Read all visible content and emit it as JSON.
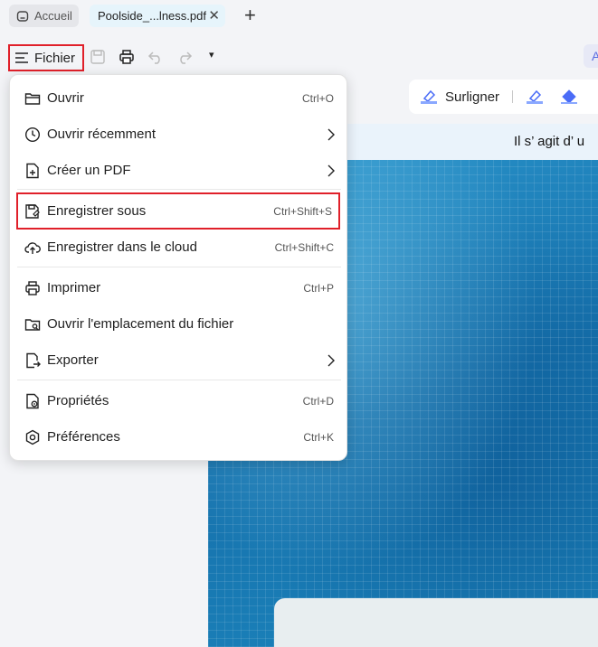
{
  "tabs": {
    "home_label": "Accueil",
    "doc_label": "Poolside_...lness.pdf",
    "close_glyph": "✕",
    "add_glyph": "+"
  },
  "toolbar": {
    "file_label": "Fichier",
    "more_glyph": "▾",
    "right_partial": "A"
  },
  "annotation": {
    "highlight_label": "Surligner"
  },
  "document": {
    "header_text": "Il s’ agit d’ u"
  },
  "menu": {
    "items": [
      {
        "label": "Ouvrir",
        "shortcut": "Ctrl+O",
        "icon": "folder-open-icon"
      },
      {
        "label": "Ouvrir récemment",
        "shortcut": "",
        "icon": "clock-icon",
        "submenu": true
      },
      {
        "label": "Créer un PDF",
        "shortcut": "",
        "icon": "create-pdf-icon",
        "submenu": true
      },
      {
        "label": "Enregistrer sous",
        "shortcut": "Ctrl+Shift+S",
        "icon": "save-as-icon",
        "highlighted": true
      },
      {
        "label": "Enregistrer dans le cloud",
        "shortcut": "Ctrl+Shift+C",
        "icon": "cloud-upload-icon"
      },
      {
        "label": "Imprimer",
        "shortcut": "Ctrl+P",
        "icon": "printer-icon"
      },
      {
        "label": "Ouvrir l'emplacement du fichier",
        "shortcut": "",
        "icon": "folder-location-icon"
      },
      {
        "label": "Exporter",
        "shortcut": "",
        "icon": "export-icon",
        "submenu": true
      },
      {
        "label": "Propriétés",
        "shortcut": "Ctrl+D",
        "icon": "properties-icon"
      },
      {
        "label": "Préférences",
        "shortcut": "Ctrl+K",
        "icon": "preferences-icon"
      }
    ]
  },
  "colors": {
    "highlight_border": "#e0202a",
    "accent": "#5b6be0"
  }
}
